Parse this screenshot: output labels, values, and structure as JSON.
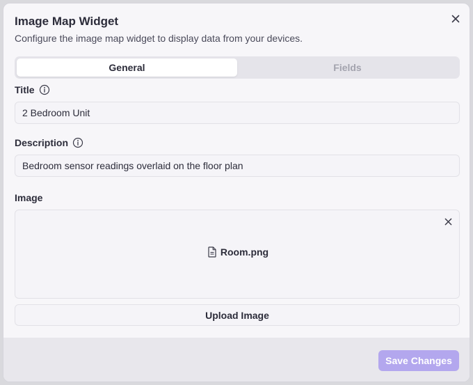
{
  "dialog": {
    "title": "Image Map Widget",
    "subtitle": "Configure the image map widget to display data from your devices."
  },
  "tabs": [
    {
      "label": "General",
      "active": true
    },
    {
      "label": "Fields",
      "active": false
    }
  ],
  "form": {
    "title_label": "Title",
    "title_value": "2 Bedroom Unit",
    "description_label": "Description",
    "description_value": "Bedroom sensor readings overlaid on the floor plan",
    "image_label": "Image",
    "image_filename": "Room.png",
    "upload_label": "Upload Image"
  },
  "footer": {
    "save_label": "Save Changes"
  },
  "icons": {
    "close": "close-icon",
    "info": "info-icon",
    "file": "file-icon",
    "remove": "remove-image-icon"
  },
  "colors": {
    "accent_disabled": "#b3a7ee",
    "text": "#2c2c3a",
    "muted": "#a3a3ae"
  }
}
